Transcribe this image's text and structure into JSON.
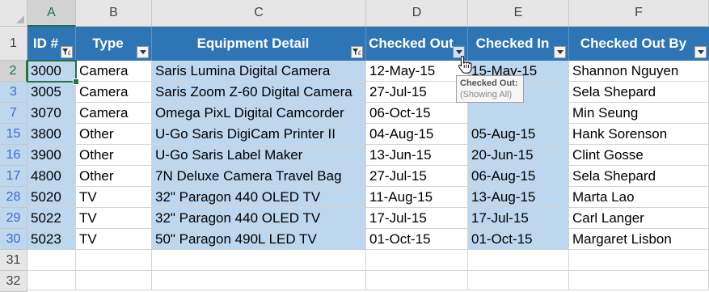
{
  "columns": [
    "A",
    "B",
    "C",
    "D",
    "E",
    "F"
  ],
  "table": {
    "headers": [
      "ID #",
      "Type",
      "Equipment Detail",
      "Checked Out",
      "Checked In",
      "Checked Out By"
    ],
    "rows": [
      {
        "rownum": "2",
        "cells": [
          "3000",
          "Camera",
          "Saris Lumina Digital Camera",
          "12-May-15",
          "15-May-15",
          "Shannon Nguyen"
        ]
      },
      {
        "rownum": "3",
        "cells": [
          "3005",
          "Camera",
          "Saris Zoom Z-60 Digital Camera",
          "27-Jul-15",
          "",
          "Sela Shepard"
        ]
      },
      {
        "rownum": "7",
        "cells": [
          "3070",
          "Camera",
          "Omega PixL Digital Camcorder",
          "06-Oct-15",
          "",
          "Min Seung"
        ]
      },
      {
        "rownum": "15",
        "cells": [
          "3800",
          "Other",
          "U-Go Saris DigiCam Printer II",
          "04-Aug-15",
          "05-Aug-15",
          "Hank Sorenson"
        ]
      },
      {
        "rownum": "16",
        "cells": [
          "3900",
          "Other",
          "U-Go Saris Label Maker",
          "13-Jun-15",
          "20-Jun-15",
          "Clint Gosse"
        ]
      },
      {
        "rownum": "17",
        "cells": [
          "4800",
          "Other",
          "7N Deluxe Camera Travel Bag",
          "27-Jul-15",
          "06-Aug-15",
          "Sela Shepard"
        ]
      },
      {
        "rownum": "28",
        "cells": [
          "5020",
          "TV",
          "32\" Paragon 440 OLED TV",
          "11-Aug-15",
          "13-Aug-15",
          "Marta Lao"
        ]
      },
      {
        "rownum": "29",
        "cells": [
          "5022",
          "TV",
          "32\" Paragon 440 OLED TV",
          "17-Jul-15",
          "17-Jul-15",
          "Carl Langer"
        ]
      },
      {
        "rownum": "30",
        "cells": [
          "5023",
          "TV",
          "50\" Paragon 490L LED TV",
          "01-Oct-15",
          "01-Oct-15",
          "Margaret Lisbon"
        ]
      }
    ],
    "empty_rows": [
      "31",
      "32"
    ]
  },
  "header_row_number": "1",
  "tooltip": {
    "title": "Checked Out:",
    "detail": "(Showing All)"
  },
  "colors": {
    "header_bg": "#2e75b6",
    "band": "#bdd7ee",
    "selection": "#217346"
  }
}
